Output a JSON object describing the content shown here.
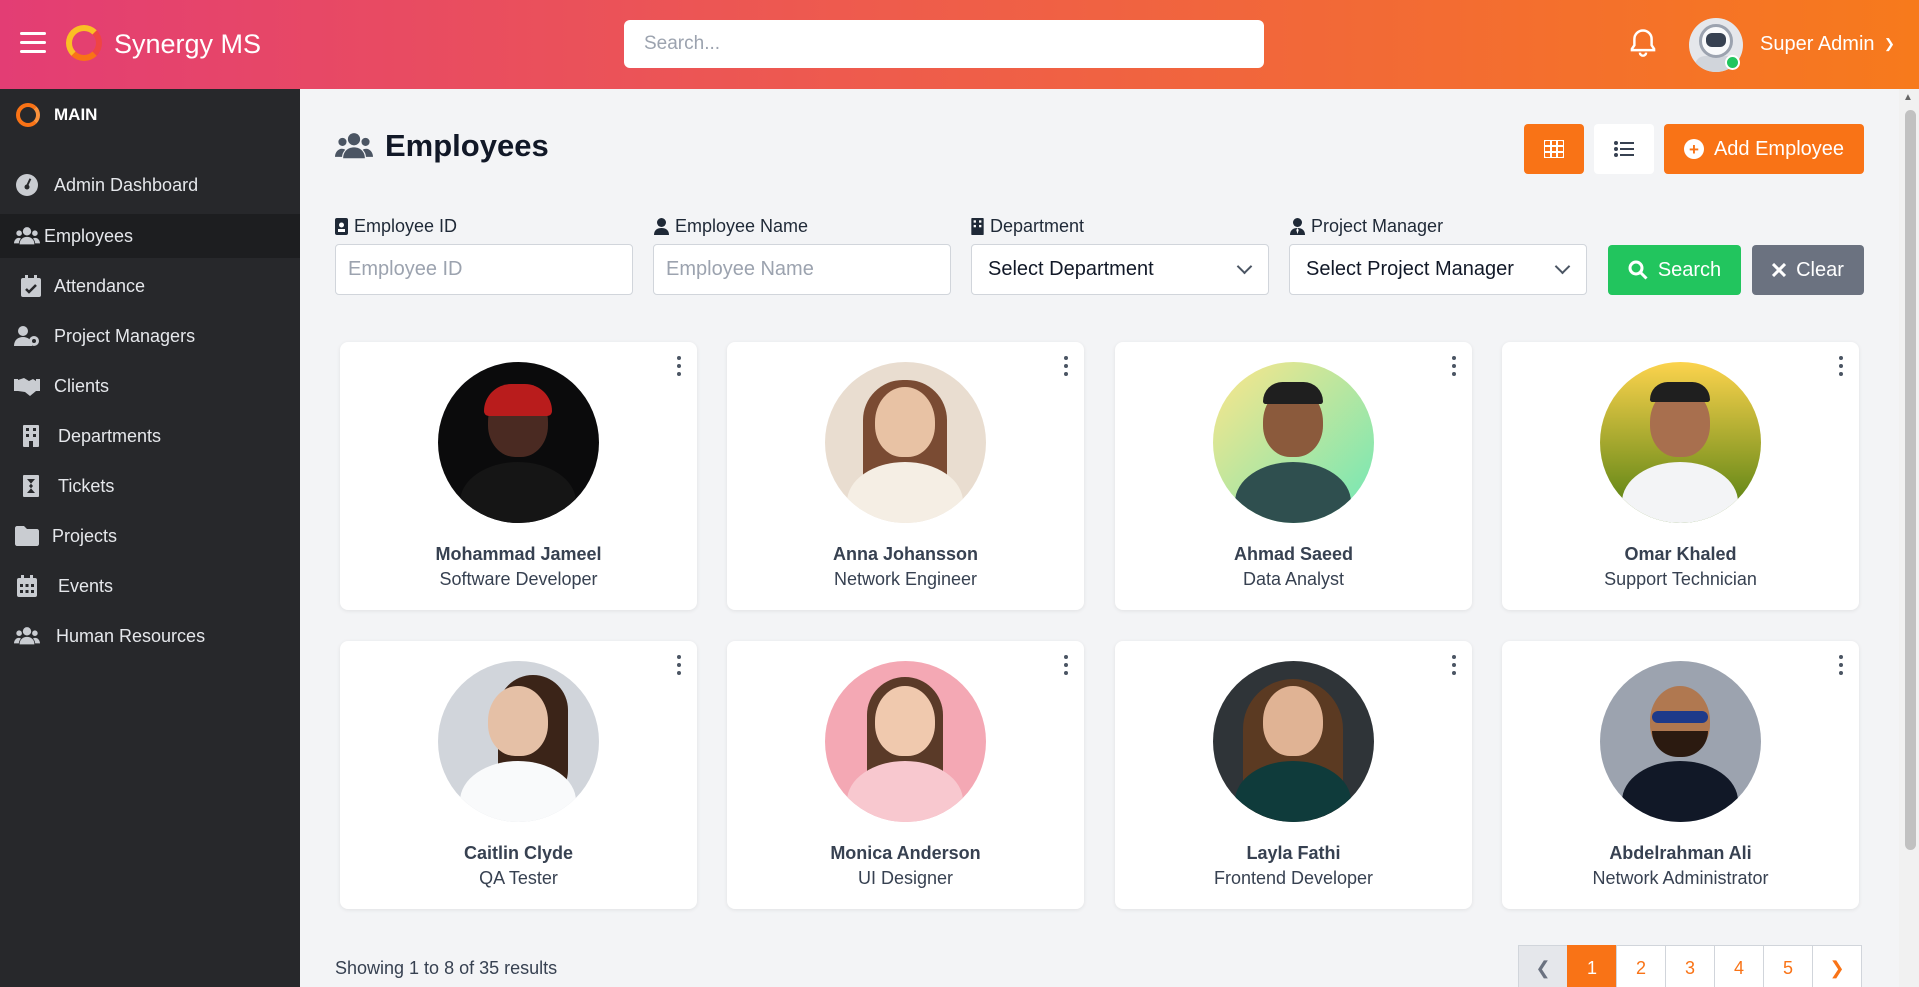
{
  "header": {
    "brand": "Synergy MS",
    "search_placeholder": "Search...",
    "user_name": "Super Admin"
  },
  "sidebar": {
    "section": "MAIN",
    "items": [
      {
        "label": "Admin Dashboard",
        "icon": "gauge-icon"
      },
      {
        "label": "Employees",
        "icon": "users-icon",
        "active": true
      },
      {
        "label": "Attendance",
        "icon": "calendar-check-icon"
      },
      {
        "label": "Project Managers",
        "icon": "user-gear-icon"
      },
      {
        "label": "Clients",
        "icon": "handshake-icon"
      },
      {
        "label": "Departments",
        "icon": "building-icon"
      },
      {
        "label": "Tickets",
        "icon": "ticket-icon"
      },
      {
        "label": "Projects",
        "icon": "folder-icon"
      },
      {
        "label": "Events",
        "icon": "calendar-icon"
      },
      {
        "label": "Human Resources",
        "icon": "people-group-icon"
      }
    ]
  },
  "page": {
    "title": "Employees",
    "add_button": "Add Employee"
  },
  "filters": {
    "employee_id_label": "Employee ID",
    "employee_id_placeholder": "Employee ID",
    "employee_name_label": "Employee Name",
    "employee_name_placeholder": "Employee Name",
    "department_label": "Department",
    "department_value": "Select Department",
    "pm_label": "Project Manager",
    "pm_value": "Select Project Manager",
    "search_button": "Search",
    "clear_button": "Clear"
  },
  "employees": [
    {
      "name": "Mohammad Jameel",
      "role": "Software Developer"
    },
    {
      "name": "Anna Johansson",
      "role": "Network Engineer"
    },
    {
      "name": "Ahmad Saeed",
      "role": "Data Analyst"
    },
    {
      "name": "Omar Khaled",
      "role": "Support Technician"
    },
    {
      "name": "Caitlin Clyde",
      "role": "QA Tester"
    },
    {
      "name": "Monica Anderson",
      "role": "UI Designer"
    },
    {
      "name": "Layla Fathi",
      "role": "Frontend Developer"
    },
    {
      "name": "Abdelrahman Ali",
      "role": "Network Administrator"
    }
  ],
  "pagination": {
    "summary": "Showing 1 to 8 of 35 results",
    "pages": [
      "1",
      "2",
      "3",
      "4",
      "5"
    ],
    "current": "1"
  },
  "colors": {
    "accent": "#f97316",
    "search_green": "#22c55e",
    "clear_gray": "#6b7280",
    "sidebar": "#27282b"
  }
}
